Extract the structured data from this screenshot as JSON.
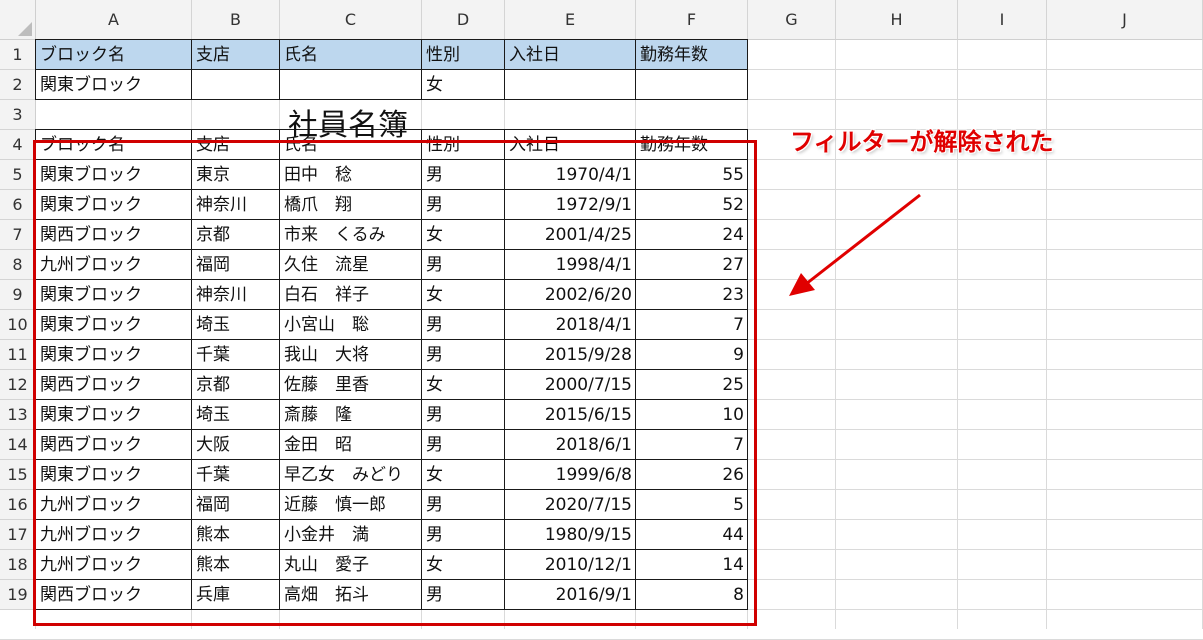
{
  "columns": [
    "A",
    "B",
    "C",
    "D",
    "E",
    "F",
    "G",
    "H",
    "I",
    "J"
  ],
  "rows": [
    "1",
    "2",
    "3",
    "4",
    "5",
    "6",
    "7",
    "8",
    "9",
    "10",
    "11",
    "12",
    "13",
    "14",
    "15",
    "16",
    "17",
    "18",
    "19"
  ],
  "criteria_header": [
    "ブロック名",
    "支店",
    "氏名",
    "性別",
    "入社日",
    "勤務年数"
  ],
  "criteria_row": [
    "関東ブロック",
    "",
    "",
    "女",
    "",
    ""
  ],
  "title": "社員名簿",
  "table_header": [
    "ブロック名",
    "支店",
    "氏名",
    "性別",
    "入社日",
    "勤務年数"
  ],
  "table_rows": [
    [
      "関東ブロック",
      "東京",
      "田中　稔",
      "男",
      "1970/4/1",
      "55"
    ],
    [
      "関東ブロック",
      "神奈川",
      "橋爪　翔",
      "男",
      "1972/9/1",
      "52"
    ],
    [
      "関西ブロック",
      "京都",
      "市来　くるみ",
      "女",
      "2001/4/25",
      "24"
    ],
    [
      "九州ブロック",
      "福岡",
      "久住　流星",
      "男",
      "1998/4/1",
      "27"
    ],
    [
      "関東ブロック",
      "神奈川",
      "白石　祥子",
      "女",
      "2002/6/20",
      "23"
    ],
    [
      "関東ブロック",
      "埼玉",
      "小宮山　聡",
      "男",
      "2018/4/1",
      "7"
    ],
    [
      "関東ブロック",
      "千葉",
      "我山　大将",
      "男",
      "2015/9/28",
      "9"
    ],
    [
      "関西ブロック",
      "京都",
      "佐藤　里香",
      "女",
      "2000/7/15",
      "25"
    ],
    [
      "関東ブロック",
      "埼玉",
      "斎藤　隆",
      "男",
      "2015/6/15",
      "10"
    ],
    [
      "関西ブロック",
      "大阪",
      "金田　昭",
      "男",
      "2018/6/1",
      "7"
    ],
    [
      "関東ブロック",
      "千葉",
      "早乙女　みどり",
      "女",
      "1999/6/8",
      "26"
    ],
    [
      "九州ブロック",
      "福岡",
      "近藤　慎一郎",
      "男",
      "2020/7/15",
      "5"
    ],
    [
      "九州ブロック",
      "熊本",
      "小金井　満",
      "男",
      "1980/9/15",
      "44"
    ],
    [
      "九州ブロック",
      "熊本",
      "丸山　愛子",
      "女",
      "2010/12/1",
      "14"
    ],
    [
      "関西ブロック",
      "兵庫",
      "高畑　拓斗",
      "男",
      "2016/9/1",
      "8"
    ]
  ],
  "annotation": {
    "text": "フィルターが解除された",
    "color": "#e00000"
  },
  "colors": {
    "header_fill": "#bdd7ee",
    "highlight_box": "#d00000"
  }
}
